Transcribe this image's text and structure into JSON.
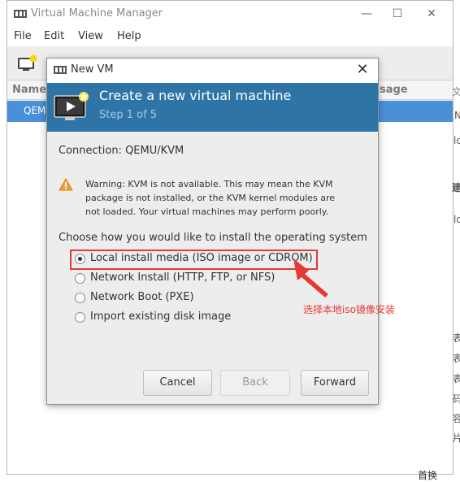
{
  "main_window": {
    "title": "Virtual Machine Manager",
    "menu": [
      "File",
      "Edit",
      "View",
      "Help"
    ],
    "columns": {
      "name": "Name",
      "usage": "sage"
    },
    "vm_name": "QEM"
  },
  "dialog": {
    "window_title": "New VM",
    "header_title": "Create a new virtual machine",
    "header_step": "Step 1 of 5",
    "connection": "Connection: QEMU/KVM",
    "warning_lines": [
      "Warning: KVM is not available. This may mean the KVM",
      "package is not installed, or the KVM kernel modules are",
      "not loaded. Your virtual machines may perform poorly."
    ],
    "choose_label": "Choose how you would like to install the operating system",
    "options": [
      {
        "label": "Local install media (ISO image or CDROM)",
        "checked": true
      },
      {
        "label": "Network Install (HTTP, FTP, or NFS)",
        "checked": false
      },
      {
        "label": "Network Boot (PXE)",
        "checked": false
      },
      {
        "label": "Import existing disk image",
        "checked": false
      }
    ],
    "buttons": {
      "cancel": "Cancel",
      "back": "Back",
      "forward": "Forward"
    }
  },
  "annotation": {
    "text": "选择本地iso镜像安装",
    "color": "#e53935"
  },
  "right_edge_chars": [
    "文",
    "N",
    "lc",
    "建",
    "ld",
    "表",
    "表",
    "表",
    "码",
    "容",
    "片",
    "首换"
  ],
  "colors": {
    "header_bg": "#2e74a7",
    "selection": "#4a90d9",
    "accent_red": "#e53935"
  }
}
